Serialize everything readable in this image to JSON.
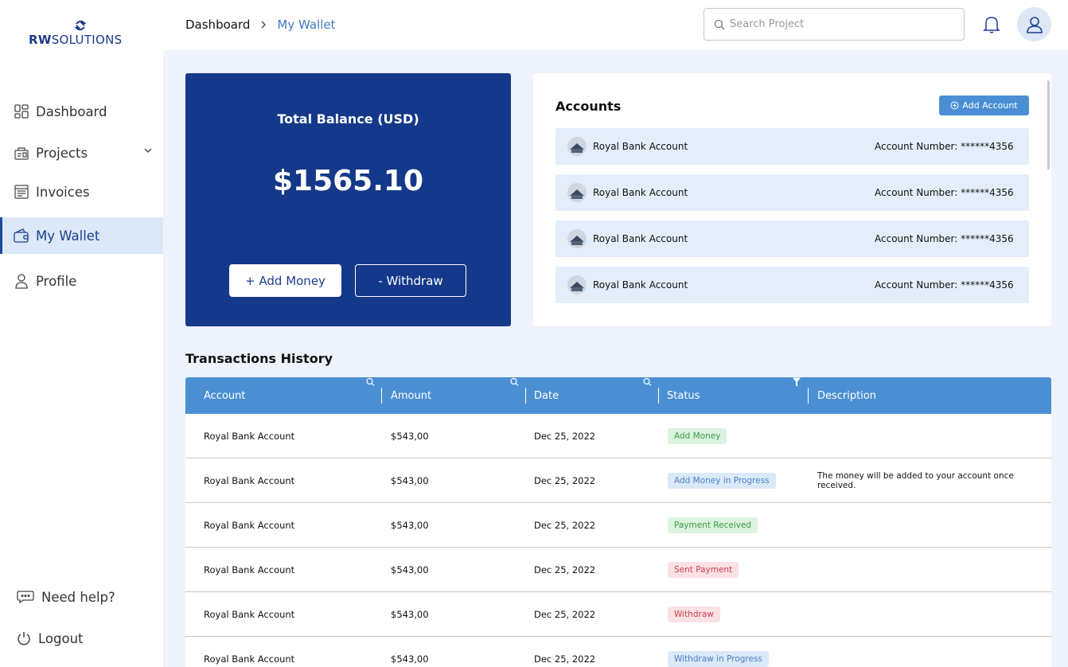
{
  "brand": {
    "name_bold": "RW",
    "name_rest": "SOLUTIONS"
  },
  "sidebar": {
    "items": [
      {
        "label": "Dashboard",
        "icon": "dashboard-icon"
      },
      {
        "label": "Projects",
        "icon": "projects-icon"
      },
      {
        "label": "Invoices",
        "icon": "invoices-icon"
      },
      {
        "label": "My Wallet",
        "icon": "wallet-icon",
        "active": true
      },
      {
        "label": "Profile",
        "icon": "profile-icon"
      }
    ],
    "help_label": "Need help?",
    "logout_label": "Logout"
  },
  "header": {
    "breadcrumb_root": "Dashboard",
    "breadcrumb_current": "My Wallet",
    "search_placeholder": "Search Project"
  },
  "balance": {
    "title": "Total Balance (USD)",
    "amount": "$1565.10",
    "add_label": "+ Add Money",
    "withdraw_label": "- Withdraw"
  },
  "accounts": {
    "title": "Accounts",
    "add_label": "Add Account",
    "rows": [
      {
        "name": "Royal Bank Account",
        "number": "Account Number: ******4356"
      },
      {
        "name": "Royal Bank Account",
        "number": "Account Number: ******4356"
      },
      {
        "name": "Royal Bank Account",
        "number": "Account Number: ******4356"
      },
      {
        "name": "Royal Bank Account",
        "number": "Account Number: ******4356"
      }
    ]
  },
  "transactions": {
    "title": "Transactions History",
    "columns": [
      "Account",
      "Amount",
      "Date",
      "Status",
      "Description"
    ],
    "rows": [
      {
        "account": "Royal Bank Account",
        "amount": "$543,00",
        "date": "Dec 25, 2022",
        "status": "Add Money",
        "status_color": "green",
        "description": ""
      },
      {
        "account": "Royal Bank Account",
        "amount": "$543,00",
        "date": "Dec 25, 2022",
        "status": "Add Money in Progress",
        "status_color": "blue",
        "description": "The money will be added to your account once received."
      },
      {
        "account": "Royal Bank Account",
        "amount": "$543,00",
        "date": "Dec 25, 2022",
        "status": "Payment Received",
        "status_color": "green",
        "description": ""
      },
      {
        "account": "Royal Bank Account",
        "amount": "$543,00",
        "date": "Dec 25, 2022",
        "status": "Sent Payment",
        "status_color": "red",
        "description": ""
      },
      {
        "account": "Royal Bank Account",
        "amount": "$543,00",
        "date": "Dec 25, 2022",
        "status": "Withdraw",
        "status_color": "red",
        "description": ""
      },
      {
        "account": "Royal Bank Account",
        "amount": "$543,00",
        "date": "Dec 25, 2022",
        "status": "Withdraw in Progress",
        "status_color": "blue",
        "description": ""
      }
    ]
  },
  "colors": {
    "brand_navy": "#14398a",
    "accent_blue": "#4b8fd3",
    "active_nav_bg": "#dce8f7",
    "page_bg": "#eef3fb"
  }
}
